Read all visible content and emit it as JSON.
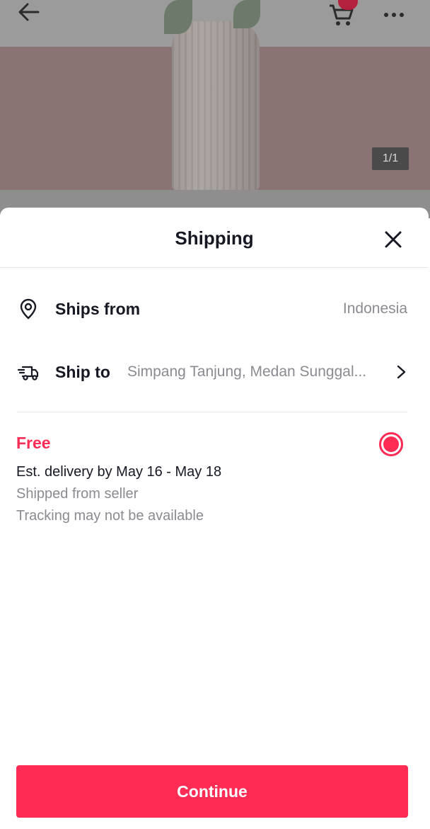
{
  "product": {
    "image_counter": "1/1"
  },
  "sheet": {
    "title": "Shipping",
    "ships_from": {
      "label": "Ships from",
      "value": "Indonesia",
      "icon": "location-pin-icon"
    },
    "ship_to": {
      "label": "Ship to",
      "value": "Simpang Tanjung, Medan Sunggal...",
      "icon": "delivery-truck-icon"
    },
    "option": {
      "title": "Free",
      "delivery": "Est. delivery by May 16 - May 18",
      "shipped": "Shipped from seller",
      "tracking": "Tracking may not be available",
      "selected": true
    },
    "continue_label": "Continue"
  },
  "colors": {
    "accent": "#fe2c55",
    "text_primary": "#161823",
    "text_secondary": "#8a8b91"
  }
}
